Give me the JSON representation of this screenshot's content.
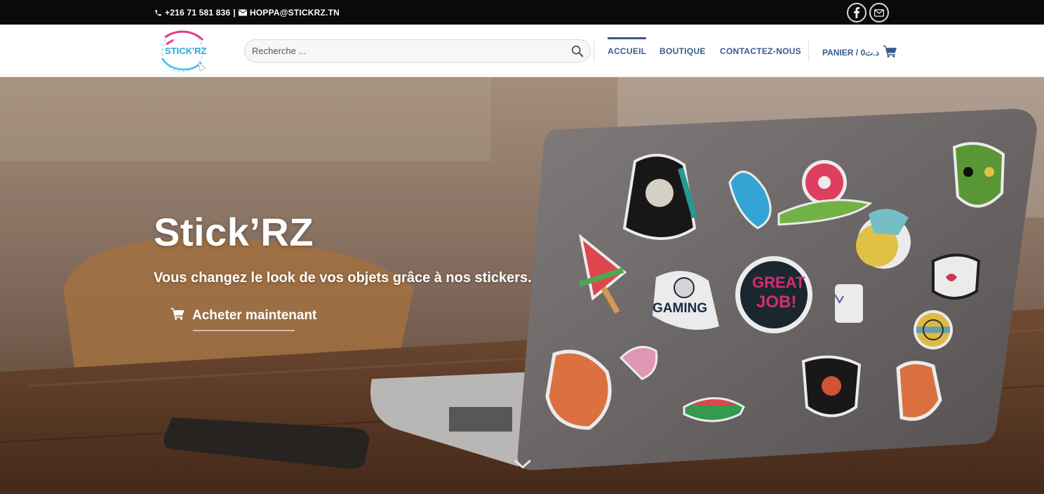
{
  "topbar": {
    "phone": "+216 71 581 836",
    "separator": "|",
    "email": "HOPPA@STICKRZ.TN",
    "phone_icon": "phone-icon",
    "email_icon": "envelope-icon",
    "social": [
      {
        "name": "facebook-icon"
      },
      {
        "name": "email-icon"
      }
    ]
  },
  "header": {
    "logo_text": "STICK'RZ",
    "search_placeholder": "Recherche ...",
    "nav": [
      {
        "label": "ACCUEIL",
        "active": true
      },
      {
        "label": "BOUTIQUE",
        "active": false
      },
      {
        "label": "CONTACTEZ-NOUS",
        "active": false
      }
    ],
    "cart_label": "PANIER / 0د.ت",
    "cart_icon": "shopping-cart-icon"
  },
  "hero": {
    "title": "Stick’RZ",
    "subtitle": "Vous changez le look de vos objets grâce à nos stickers.",
    "cta_label": "Acheter maintenant",
    "cta_icon": "shopping-cart-icon",
    "scroll_icon": "chevron-down-icon"
  },
  "colors": {
    "topbar_bg": "#0a0a0a",
    "nav_text": "#3a5b8c",
    "header_bg": "#ffffff"
  }
}
